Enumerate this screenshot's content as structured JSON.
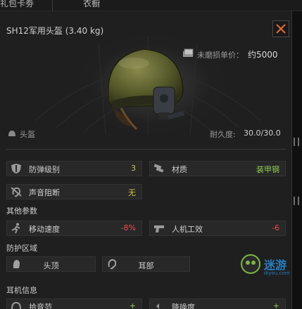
{
  "top_tabs": [
    "礼包卡劵",
    "衣橱"
  ],
  "item": {
    "title": "SH12军用头盔 (3.40 kg)",
    "price_label": "未磨损单价：",
    "price_value": "约5000",
    "type_label": "头盔",
    "durability_label": "耐久度:",
    "durability_value": "30.0/30.0"
  },
  "stats_main": [
    {
      "label": "防弹级别",
      "value": "3",
      "color": "#c9c94a",
      "icon": "shield-icon"
    },
    {
      "label": "材质",
      "value": "装甲钢",
      "color": "#8fd14f",
      "icon": "armor-plates-icon"
    },
    {
      "label": "声音阻断",
      "value": "无",
      "color": "#c9c94a",
      "icon": "ear-blocked-icon"
    }
  ],
  "sections": {
    "other": "其他参数",
    "protection": "防护区域",
    "headset": "耳机信息"
  },
  "stats_other": [
    {
      "label": "移动速度",
      "value": "-8%",
      "color": "#ef4a4a",
      "icon": "running-icon"
    },
    {
      "label": "人机工效",
      "value": "-6",
      "color": "#ef4a4a",
      "icon": "pistol-icon"
    }
  ],
  "zones": [
    {
      "label": "头顶",
      "icon": "head-icon"
    },
    {
      "label": "耳部",
      "icon": "ear-icon"
    }
  ],
  "headset_partial": [
    "拾音范",
    "降噪度"
  ],
  "watermark": {
    "text": "迷游",
    "sub": "diyou.com"
  },
  "colors": {
    "accent_close": "#e06a3a",
    "positive": "#8fd14f",
    "negative": "#ef4a4a",
    "neutral": "#c9c94a"
  }
}
